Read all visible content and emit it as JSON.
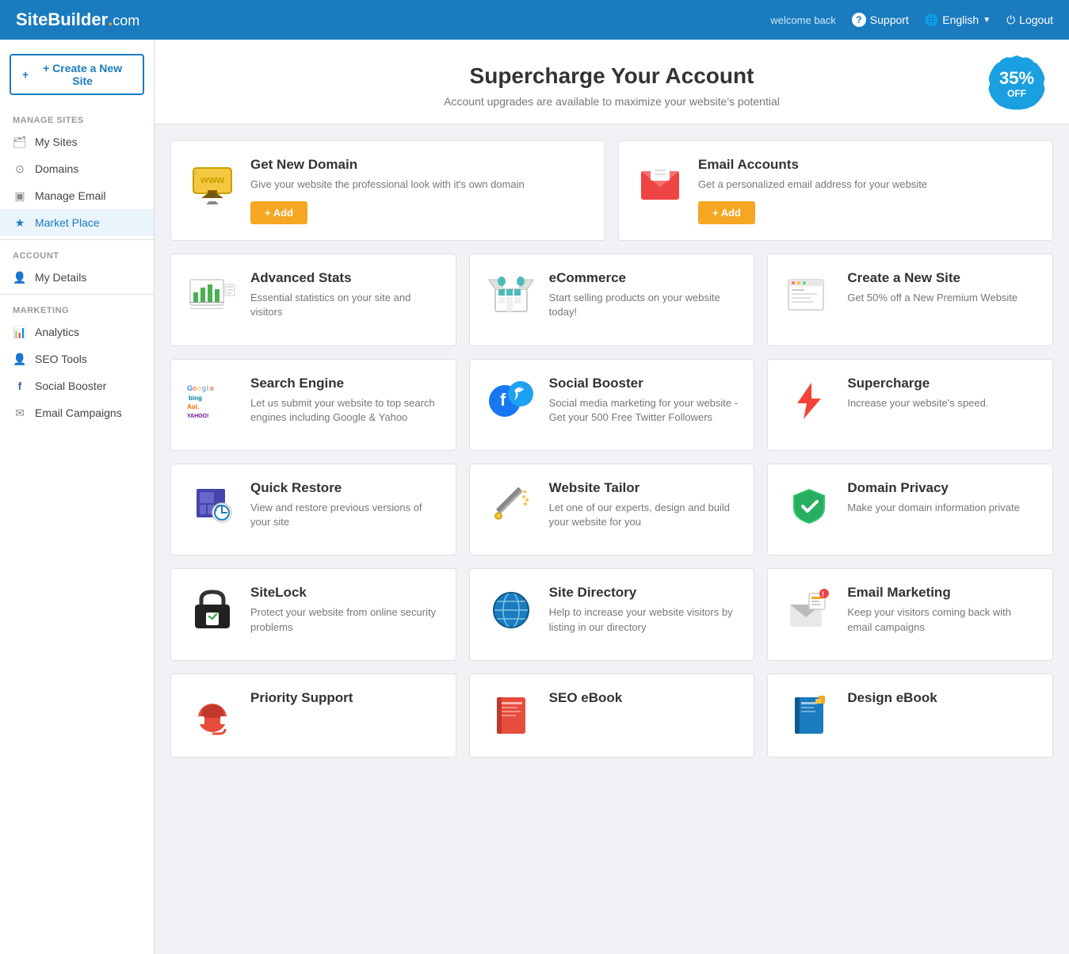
{
  "header": {
    "logo_site": "SiteBuilder",
    "logo_dot": ".",
    "logo_com": "com",
    "welcome": "welcome back",
    "support": "Support",
    "language": "English",
    "logout": "Logout"
  },
  "sidebar": {
    "create_btn": "+ Create a New Site",
    "manage_sites_title": "MANAGE SITES",
    "account_title": "ACCOUNT",
    "marketing_title": "MARKETING",
    "manage_sites_items": [
      {
        "label": "My Sites",
        "icon": "🗂"
      },
      {
        "label": "Domains",
        "icon": "🌐"
      },
      {
        "label": "Manage Email",
        "icon": "📧"
      },
      {
        "label": "Market Place",
        "icon": "★",
        "active": true
      }
    ],
    "account_items": [
      {
        "label": "My Details",
        "icon": "👤"
      }
    ],
    "marketing_items": [
      {
        "label": "Analytics",
        "icon": "📊"
      },
      {
        "label": "SEO Tools",
        "icon": "👤"
      },
      {
        "label": "Social Booster",
        "icon": "f"
      },
      {
        "label": "Email Campaigns",
        "icon": "✉"
      }
    ]
  },
  "hero": {
    "title": "Supercharge Your Account",
    "subtitle": "Account upgrades are available to maximize your website's potential",
    "badge_percent": "35%",
    "badge_off": "OFF"
  },
  "top_cards": [
    {
      "id": "domain",
      "title": "Get New Domain",
      "desc": "Give your website the professional look with it's own domain",
      "btn": "+ Add",
      "icon_color": "#c8a000",
      "icon_type": "domain"
    },
    {
      "id": "email-accounts",
      "title": "Email Accounts",
      "desc": "Get a personalized email address for your website",
      "btn": "+ Add",
      "icon_type": "email"
    }
  ],
  "mid_cards_row1": [
    {
      "id": "advanced-stats",
      "title": "Advanced Stats",
      "desc": "Essential statistics on your site and visitors",
      "icon_type": "stats"
    },
    {
      "id": "ecommerce",
      "title": "eCommerce",
      "desc": "Start selling products on your website today!",
      "icon_type": "ecommerce"
    },
    {
      "id": "create-site",
      "title": "Create a New Site",
      "desc": "Get 50% off a New Premium Website",
      "icon_type": "newsite"
    }
  ],
  "mid_cards_row2": [
    {
      "id": "search-engine",
      "title": "Search Engine",
      "desc": "Let us submit your website to top search engines including Google & Yahoo",
      "icon_type": "search-engine"
    },
    {
      "id": "social-booster",
      "title": "Social Booster",
      "desc": "Social media marketing for your website - Get your 500 Free Twitter Followers",
      "icon_type": "social"
    },
    {
      "id": "supercharge",
      "title": "Supercharge",
      "desc": "Increase your website's speed.",
      "icon_type": "bolt"
    }
  ],
  "mid_cards_row3": [
    {
      "id": "quick-restore",
      "title": "Quick Restore",
      "desc": "View and restore previous versions of your site",
      "icon_type": "restore"
    },
    {
      "id": "website-tailor",
      "title": "Website Tailor",
      "desc": "Let one of our experts, design and build your website for you",
      "icon_type": "tailor"
    },
    {
      "id": "domain-privacy",
      "title": "Domain Privacy",
      "desc": "Make your domain information private",
      "icon_type": "privacy"
    }
  ],
  "mid_cards_row4": [
    {
      "id": "sitelock",
      "title": "SiteLock",
      "desc": "Protect your website from online security problems",
      "icon_type": "sitelock"
    },
    {
      "id": "site-directory",
      "title": "Site Directory",
      "desc": "Help to increase your website visitors by listing in our directory",
      "icon_type": "directory"
    },
    {
      "id": "email-marketing",
      "title": "Email Marketing",
      "desc": "Keep your visitors coming back with email campaigns",
      "icon_type": "email-marketing"
    }
  ],
  "bottom_row": [
    {
      "id": "priority-support",
      "title": "Priority Support",
      "icon_type": "priority-support"
    },
    {
      "id": "seo-ebook",
      "title": "SEO eBook",
      "icon_type": "seo-ebook"
    },
    {
      "id": "design-ebook",
      "title": "Design eBook",
      "icon_type": "design-ebook"
    }
  ]
}
